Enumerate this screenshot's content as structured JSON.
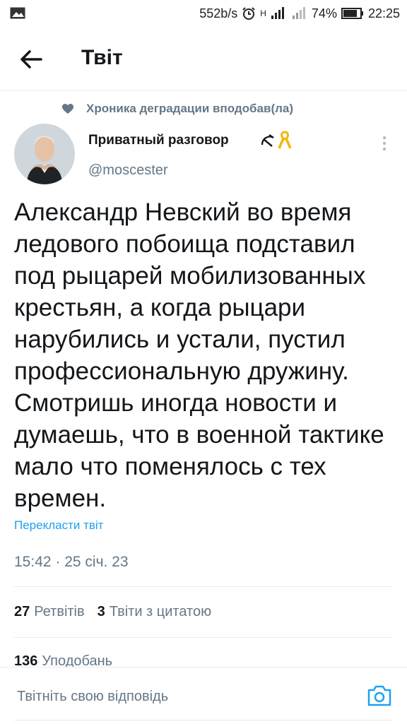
{
  "status_bar": {
    "network_speed": "552b/s",
    "network_label": "H",
    "battery": "74%",
    "time": "22:25"
  },
  "header": {
    "title": "Твіт",
    "back_icon": "arrow-left-icon"
  },
  "social_context": {
    "icon": "heart-icon",
    "text": "Хроника деградации вподобав(ла)"
  },
  "tweet": {
    "author_name": "Приватный разговор",
    "author_handle": "@moscester",
    "text": "Александр Невский во время\nледового побоища подставил\nпод рыцарей мобилизованных\nкрестьян, а когда рыцари\nнарубились и устали, пустил\nпрофессиональную дружину.\nСмотришь иногда новости и\nдумаешь, что в военной тактике\nмало что поменялось с тех\nвремен.",
    "translate_label": "Перекласти твіт",
    "timestamp": "15:42 · 25 січ. 23"
  },
  "stats": {
    "retweets_count": "27",
    "retweets_label": "Ретвітів",
    "quotes_count": "3",
    "quotes_label": "Твіти з цитатою",
    "likes_count": "136",
    "likes_label": "Уподобань"
  },
  "reply": {
    "placeholder": "Твітніть свою відповідь",
    "camera_icon": "camera-icon"
  },
  "colors": {
    "accent": "#1da1f2",
    "secondary_text": "#657786",
    "primary_text": "#14171a",
    "divider": "#e6ecf0"
  }
}
